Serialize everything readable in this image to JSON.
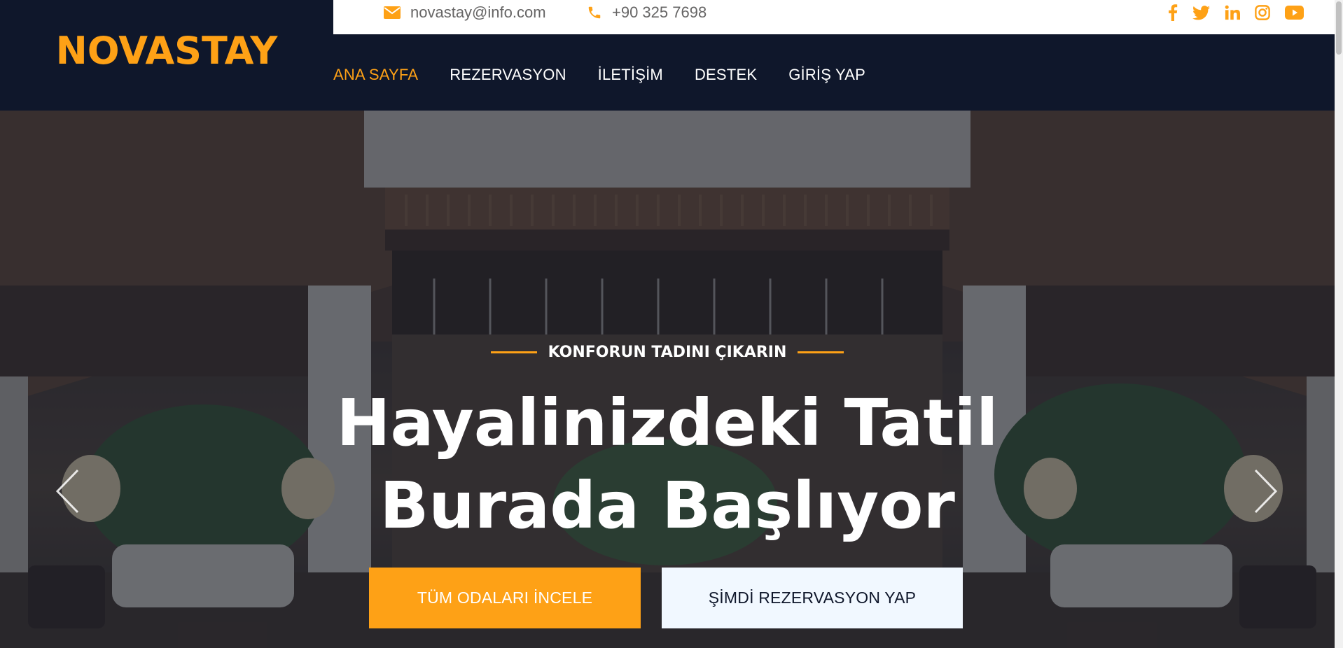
{
  "brand": {
    "name": "NOVASTAY"
  },
  "topbar": {
    "email": "novastay@info.com",
    "phone": "+90 325 7698",
    "email_icon": "envelope-icon",
    "phone_icon": "phone-icon",
    "socials": [
      "facebook-icon",
      "twitter-icon",
      "linkedin-icon",
      "instagram-icon",
      "youtube-icon"
    ]
  },
  "nav": {
    "items": [
      {
        "label": "ANA SAYFA",
        "active": true
      },
      {
        "label": "REZERVASYON",
        "active": false
      },
      {
        "label": "İLETİŞİM",
        "active": false
      },
      {
        "label": "DESTEK",
        "active": false
      },
      {
        "label": "GİRİŞ YAP",
        "active": false
      }
    ]
  },
  "hero": {
    "eyebrow": "KONFORUN TADINI ÇIKARIN",
    "title_line1": "Hayalinizdeki Tatil",
    "title_line2": "Burada Başlıyor",
    "primary_button": "TÜM ODALARI İNCELE",
    "secondary_button": "ŞİMDİ REZERVASYON YAP"
  },
  "colors": {
    "accent": "#fea116",
    "dark": "#0f172b",
    "light_button": "#f1f8ff"
  }
}
